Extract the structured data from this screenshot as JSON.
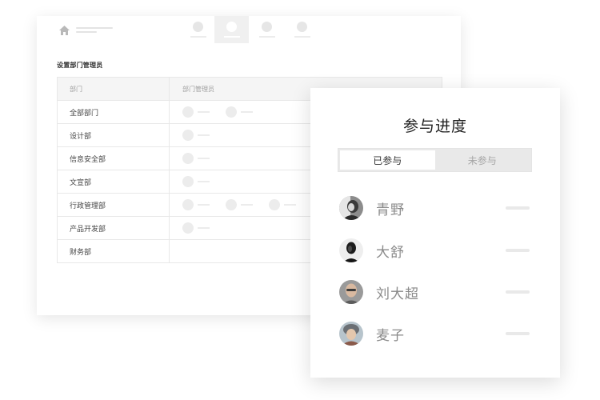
{
  "admin_window": {
    "section_title": "设置部门管理员",
    "table": {
      "columns": [
        "部门",
        "部门管理员"
      ],
      "rows": [
        {
          "dept": "全部部门",
          "managers": 2
        },
        {
          "dept": "设计部",
          "managers": 1
        },
        {
          "dept": "信息安全部",
          "managers": 1
        },
        {
          "dept": "文宣部",
          "managers": 1
        },
        {
          "dept": "行政管理部",
          "managers": 3
        },
        {
          "dept": "产品开发部",
          "managers": 1
        },
        {
          "dept": "财务部",
          "managers": 0
        }
      ]
    },
    "nav": {
      "active_index": 1,
      "count": 4
    }
  },
  "progress_panel": {
    "title": "参与进度",
    "tabs": [
      {
        "label": "已参与",
        "active": true
      },
      {
        "label": "未参与",
        "active": false
      }
    ],
    "members": [
      {
        "name": "青野",
        "avatar": "avatar-photo-1"
      },
      {
        "name": "大舒",
        "avatar": "avatar-photo-2"
      },
      {
        "name": "刘大超",
        "avatar": "avatar-photo-3"
      },
      {
        "name": "麦子",
        "avatar": "avatar-photo-4"
      }
    ]
  },
  "colors": {
    "placeholder": "#ececec",
    "panel_title": "#222222",
    "member_name": "#8a8a8a"
  }
}
